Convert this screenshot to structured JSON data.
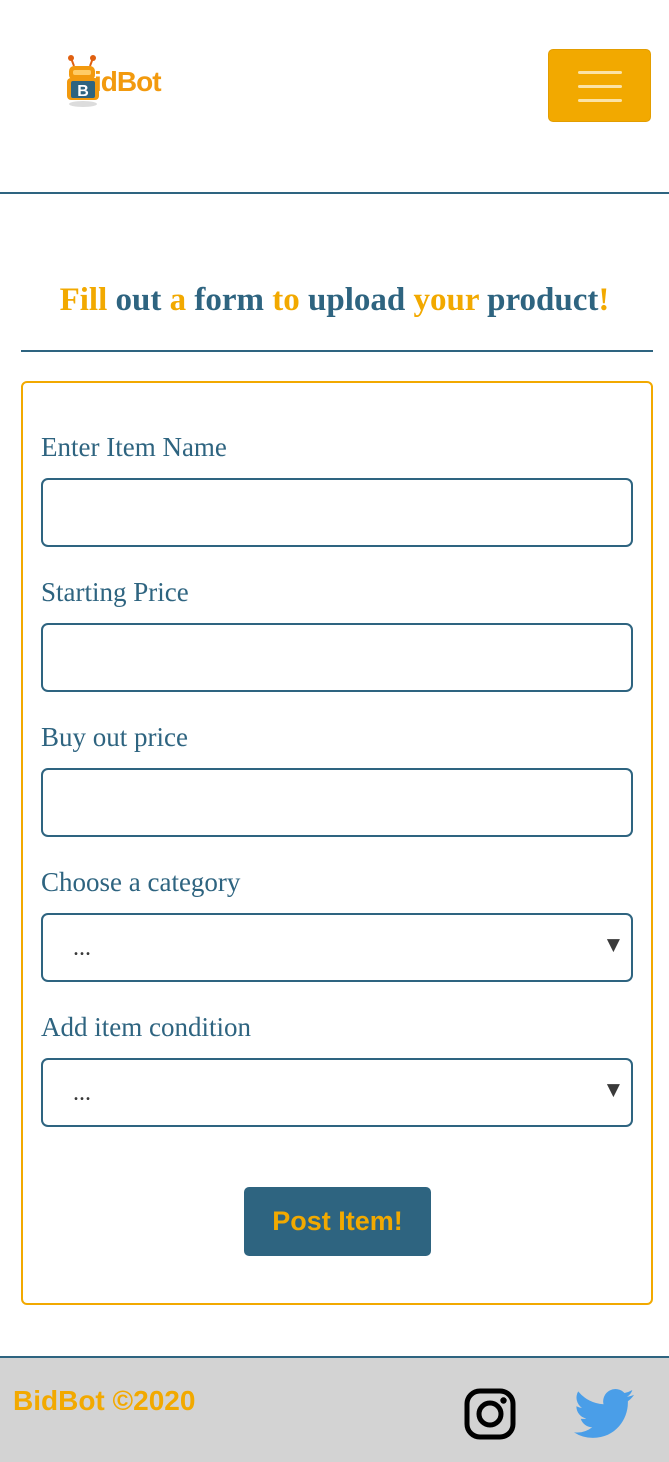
{
  "header": {
    "logo": {
      "text_b": "B",
      "text_rest": "idBot"
    },
    "menu_button": {
      "icon": "hamburger-menu-icon"
    }
  },
  "page": {
    "heading_words": [
      "Fill",
      "out",
      "a",
      "form",
      "to",
      "upload",
      "your",
      "product",
      "!"
    ]
  },
  "form": {
    "item_name": {
      "label": "Enter Item Name",
      "value": ""
    },
    "starting_price": {
      "label": "Starting Price",
      "value": ""
    },
    "buyout_price": {
      "label": "Buy out price",
      "value": ""
    },
    "category": {
      "label": "Choose a category",
      "selected": "..."
    },
    "condition": {
      "label": "Add item condition",
      "selected": "..."
    },
    "submit_label": "Post Item!"
  },
  "footer": {
    "copyright": "BidBot ©2020",
    "social": [
      "instagram-icon",
      "twitter-icon"
    ]
  },
  "colors": {
    "primary": "#2e6480",
    "accent": "#f2a900",
    "footer_bg": "#d3d3d3",
    "twitter": "#4a9ee8"
  }
}
